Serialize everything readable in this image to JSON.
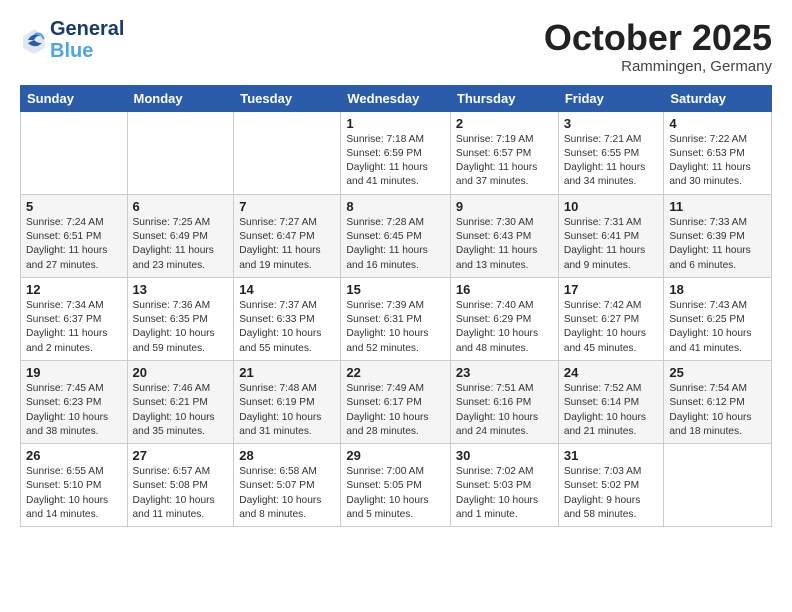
{
  "header": {
    "logo_line1": "General",
    "logo_line2": "Blue",
    "month": "October 2025",
    "location": "Rammingen, Germany"
  },
  "days_of_week": [
    "Sunday",
    "Monday",
    "Tuesday",
    "Wednesday",
    "Thursday",
    "Friday",
    "Saturday"
  ],
  "weeks": [
    [
      {
        "num": "",
        "sunrise": "",
        "sunset": "",
        "daylight": ""
      },
      {
        "num": "",
        "sunrise": "",
        "sunset": "",
        "daylight": ""
      },
      {
        "num": "",
        "sunrise": "",
        "sunset": "",
        "daylight": ""
      },
      {
        "num": "1",
        "sunrise": "Sunrise: 7:18 AM",
        "sunset": "Sunset: 6:59 PM",
        "daylight": "Daylight: 11 hours and 41 minutes."
      },
      {
        "num": "2",
        "sunrise": "Sunrise: 7:19 AM",
        "sunset": "Sunset: 6:57 PM",
        "daylight": "Daylight: 11 hours and 37 minutes."
      },
      {
        "num": "3",
        "sunrise": "Sunrise: 7:21 AM",
        "sunset": "Sunset: 6:55 PM",
        "daylight": "Daylight: 11 hours and 34 minutes."
      },
      {
        "num": "4",
        "sunrise": "Sunrise: 7:22 AM",
        "sunset": "Sunset: 6:53 PM",
        "daylight": "Daylight: 11 hours and 30 minutes."
      }
    ],
    [
      {
        "num": "5",
        "sunrise": "Sunrise: 7:24 AM",
        "sunset": "Sunset: 6:51 PM",
        "daylight": "Daylight: 11 hours and 27 minutes."
      },
      {
        "num": "6",
        "sunrise": "Sunrise: 7:25 AM",
        "sunset": "Sunset: 6:49 PM",
        "daylight": "Daylight: 11 hours and 23 minutes."
      },
      {
        "num": "7",
        "sunrise": "Sunrise: 7:27 AM",
        "sunset": "Sunset: 6:47 PM",
        "daylight": "Daylight: 11 hours and 19 minutes."
      },
      {
        "num": "8",
        "sunrise": "Sunrise: 7:28 AM",
        "sunset": "Sunset: 6:45 PM",
        "daylight": "Daylight: 11 hours and 16 minutes."
      },
      {
        "num": "9",
        "sunrise": "Sunrise: 7:30 AM",
        "sunset": "Sunset: 6:43 PM",
        "daylight": "Daylight: 11 hours and 13 minutes."
      },
      {
        "num": "10",
        "sunrise": "Sunrise: 7:31 AM",
        "sunset": "Sunset: 6:41 PM",
        "daylight": "Daylight: 11 hours and 9 minutes."
      },
      {
        "num": "11",
        "sunrise": "Sunrise: 7:33 AM",
        "sunset": "Sunset: 6:39 PM",
        "daylight": "Daylight: 11 hours and 6 minutes."
      }
    ],
    [
      {
        "num": "12",
        "sunrise": "Sunrise: 7:34 AM",
        "sunset": "Sunset: 6:37 PM",
        "daylight": "Daylight: 11 hours and 2 minutes."
      },
      {
        "num": "13",
        "sunrise": "Sunrise: 7:36 AM",
        "sunset": "Sunset: 6:35 PM",
        "daylight": "Daylight: 10 hours and 59 minutes."
      },
      {
        "num": "14",
        "sunrise": "Sunrise: 7:37 AM",
        "sunset": "Sunset: 6:33 PM",
        "daylight": "Daylight: 10 hours and 55 minutes."
      },
      {
        "num": "15",
        "sunrise": "Sunrise: 7:39 AM",
        "sunset": "Sunset: 6:31 PM",
        "daylight": "Daylight: 10 hours and 52 minutes."
      },
      {
        "num": "16",
        "sunrise": "Sunrise: 7:40 AM",
        "sunset": "Sunset: 6:29 PM",
        "daylight": "Daylight: 10 hours and 48 minutes."
      },
      {
        "num": "17",
        "sunrise": "Sunrise: 7:42 AM",
        "sunset": "Sunset: 6:27 PM",
        "daylight": "Daylight: 10 hours and 45 minutes."
      },
      {
        "num": "18",
        "sunrise": "Sunrise: 7:43 AM",
        "sunset": "Sunset: 6:25 PM",
        "daylight": "Daylight: 10 hours and 41 minutes."
      }
    ],
    [
      {
        "num": "19",
        "sunrise": "Sunrise: 7:45 AM",
        "sunset": "Sunset: 6:23 PM",
        "daylight": "Daylight: 10 hours and 38 minutes."
      },
      {
        "num": "20",
        "sunrise": "Sunrise: 7:46 AM",
        "sunset": "Sunset: 6:21 PM",
        "daylight": "Daylight: 10 hours and 35 minutes."
      },
      {
        "num": "21",
        "sunrise": "Sunrise: 7:48 AM",
        "sunset": "Sunset: 6:19 PM",
        "daylight": "Daylight: 10 hours and 31 minutes."
      },
      {
        "num": "22",
        "sunrise": "Sunrise: 7:49 AM",
        "sunset": "Sunset: 6:17 PM",
        "daylight": "Daylight: 10 hours and 28 minutes."
      },
      {
        "num": "23",
        "sunrise": "Sunrise: 7:51 AM",
        "sunset": "Sunset: 6:16 PM",
        "daylight": "Daylight: 10 hours and 24 minutes."
      },
      {
        "num": "24",
        "sunrise": "Sunrise: 7:52 AM",
        "sunset": "Sunset: 6:14 PM",
        "daylight": "Daylight: 10 hours and 21 minutes."
      },
      {
        "num": "25",
        "sunrise": "Sunrise: 7:54 AM",
        "sunset": "Sunset: 6:12 PM",
        "daylight": "Daylight: 10 hours and 18 minutes."
      }
    ],
    [
      {
        "num": "26",
        "sunrise": "Sunrise: 6:55 AM",
        "sunset": "Sunset: 5:10 PM",
        "daylight": "Daylight: 10 hours and 14 minutes."
      },
      {
        "num": "27",
        "sunrise": "Sunrise: 6:57 AM",
        "sunset": "Sunset: 5:08 PM",
        "daylight": "Daylight: 10 hours and 11 minutes."
      },
      {
        "num": "28",
        "sunrise": "Sunrise: 6:58 AM",
        "sunset": "Sunset: 5:07 PM",
        "daylight": "Daylight: 10 hours and 8 minutes."
      },
      {
        "num": "29",
        "sunrise": "Sunrise: 7:00 AM",
        "sunset": "Sunset: 5:05 PM",
        "daylight": "Daylight: 10 hours and 5 minutes."
      },
      {
        "num": "30",
        "sunrise": "Sunrise: 7:02 AM",
        "sunset": "Sunset: 5:03 PM",
        "daylight": "Daylight: 10 hours and 1 minute."
      },
      {
        "num": "31",
        "sunrise": "Sunrise: 7:03 AM",
        "sunset": "Sunset: 5:02 PM",
        "daylight": "Daylight: 9 hours and 58 minutes."
      },
      {
        "num": "",
        "sunrise": "",
        "sunset": "",
        "daylight": ""
      }
    ]
  ]
}
